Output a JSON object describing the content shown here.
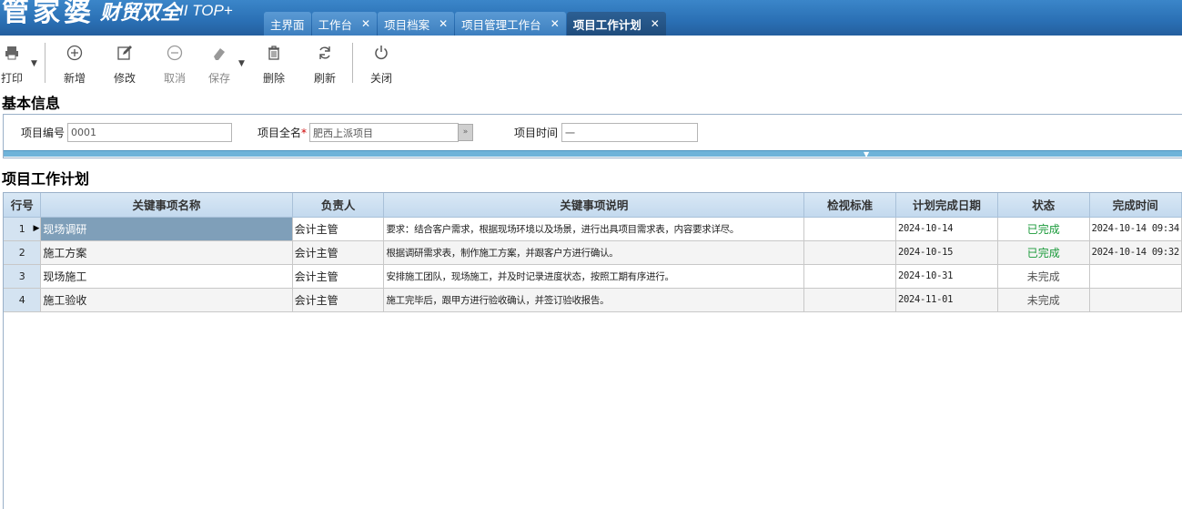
{
  "app": {
    "logo_main": "管家婆",
    "logo_sub": "财贸双全",
    "logo_version": "II TOP+"
  },
  "tabs": [
    {
      "label": "主界面",
      "closable": false,
      "active": false
    },
    {
      "label": "工作台",
      "closable": true,
      "active": false
    },
    {
      "label": "项目档案",
      "closable": true,
      "active": false
    },
    {
      "label": "项目管理工作台",
      "closable": true,
      "active": false
    },
    {
      "label": "项目工作计划",
      "closable": true,
      "active": true
    }
  ],
  "tab_close_glyph": "✕",
  "toolbar": {
    "print": "打印",
    "add": "新增",
    "edit": "修改",
    "cancel": "取消",
    "save": "保存",
    "delete": "删除",
    "refresh": "刷新",
    "close": "关闭"
  },
  "basic_info": {
    "title": "基本信息",
    "project_code_label": "项目编号",
    "project_code_value": "0001",
    "project_name_label": "项目全名",
    "project_name_value": "肥西上派项目",
    "project_time_label": "项目时间",
    "project_time_value": "一"
  },
  "plan": {
    "title": "项目工作计划",
    "columns": [
      "行号",
      "关键事项名称",
      "负责人",
      "关键事项说明",
      "检视标准",
      "计划完成日期",
      "状态",
      "完成时间"
    ],
    "rows": [
      {
        "no": "1",
        "name": "现场调研",
        "owner": "会计主管",
        "desc": "要求：结合客户需求，根据现场环境以及场景，进行出具项目需求表，内容要求详尽。",
        "standard": "",
        "plan_date": "2024-10-14",
        "status": "已完成",
        "done_time": "2024-10-14 09:34"
      },
      {
        "no": "2",
        "name": "施工方案",
        "owner": "会计主管",
        "desc": "根据调研需求表，制作施工方案，并跟客户方进行确认。",
        "standard": "",
        "plan_date": "2024-10-15",
        "status": "已完成",
        "done_time": "2024-10-14 09:32"
      },
      {
        "no": "3",
        "name": "现场施工",
        "owner": "会计主管",
        "desc": "安排施工团队，现场施工，并及时记录进度状态，按照工期有序进行。",
        "standard": "",
        "plan_date": "2024-10-31",
        "status": "未完成",
        "done_time": ""
      },
      {
        "no": "4",
        "name": "施工验收",
        "owner": "会计主管",
        "desc": "施工完毕后，跟甲方进行验收确认，并签订验收报告。",
        "standard": "",
        "plan_date": "2024-11-01",
        "status": "未完成",
        "done_time": ""
      }
    ]
  },
  "colors": {
    "title_bar": "#2a6fb4",
    "active_tab": "#1f4c7c",
    "done_status": "#1a9a3a",
    "selected_cell": "#7f9fb9",
    "header_bg": "#c3d9ee"
  }
}
